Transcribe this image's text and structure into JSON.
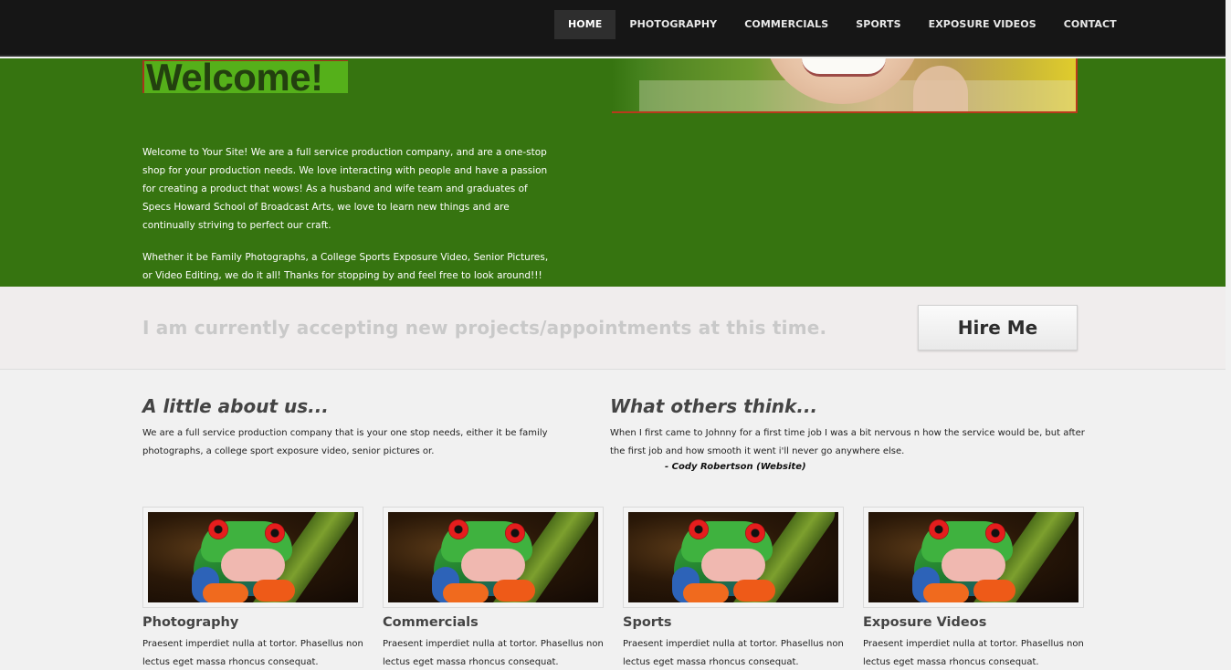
{
  "nav": {
    "items": [
      {
        "label": "HOME",
        "active": true
      },
      {
        "label": "PHOTOGRAPHY",
        "active": false
      },
      {
        "label": "COMMERCIALS",
        "active": false
      },
      {
        "label": "SPORTS",
        "active": false
      },
      {
        "label": "EXPOSURE VIDEOS",
        "active": false
      },
      {
        "label": "CONTACT",
        "active": false
      }
    ]
  },
  "hero": {
    "title": "Welcome!",
    "paragraph1": "Welcome to Your Site! We are a full service production company, and are a one-stop shop for your production needs. We love interacting with people and have a passion for creating a product that wows! As a husband and wife team and graduates of Specs Howard School of Broadcast Arts, we love to learn new things and are continually striving to perfect our craft.",
    "paragraph2": "Whether it be Family Photographs, a College Sports Exposure Video, Senior Pictures, or Video Editing, we do it all! Thanks for stopping by and feel free to look around!!!"
  },
  "banner": {
    "text": "I am currently accepting new projects/appointments at this time.",
    "button_label": "Hire Me"
  },
  "about": {
    "title": "A little about us...",
    "text": "We are a full service production company that is your one stop needs, either it be family photographs, a college sport exposure video, senior pictures or."
  },
  "testimonial": {
    "title": "What others think...",
    "text": "When I first came to Johnny for a first time job I was a bit nervous n how the service would be, but after the first job and how smooth it went i'll never go anywhere else.",
    "author": "- Cody Robertson (Website)"
  },
  "cards": [
    {
      "title": "Photography",
      "text": "Praesent imperdiet nulla at tortor. Phasellus non lectus eget massa rhoncus consequat."
    },
    {
      "title": "Commercials",
      "text": "Praesent imperdiet nulla at tortor. Phasellus non lectus eget massa rhoncus consequat."
    },
    {
      "title": "Sports",
      "text": "Praesent imperdiet nulla at tortor. Phasellus non lectus eget massa rhoncus consequat."
    },
    {
      "title": "Exposure Videos",
      "text": "Praesent imperdiet nulla at tortor. Phasellus non lectus eget massa rhoncus consequat."
    }
  ],
  "colors": {
    "nav_bg": "#161616",
    "hero_bg": "#367410",
    "banner_bg": "#f0eded",
    "page_bg": "#f1f1f1"
  }
}
